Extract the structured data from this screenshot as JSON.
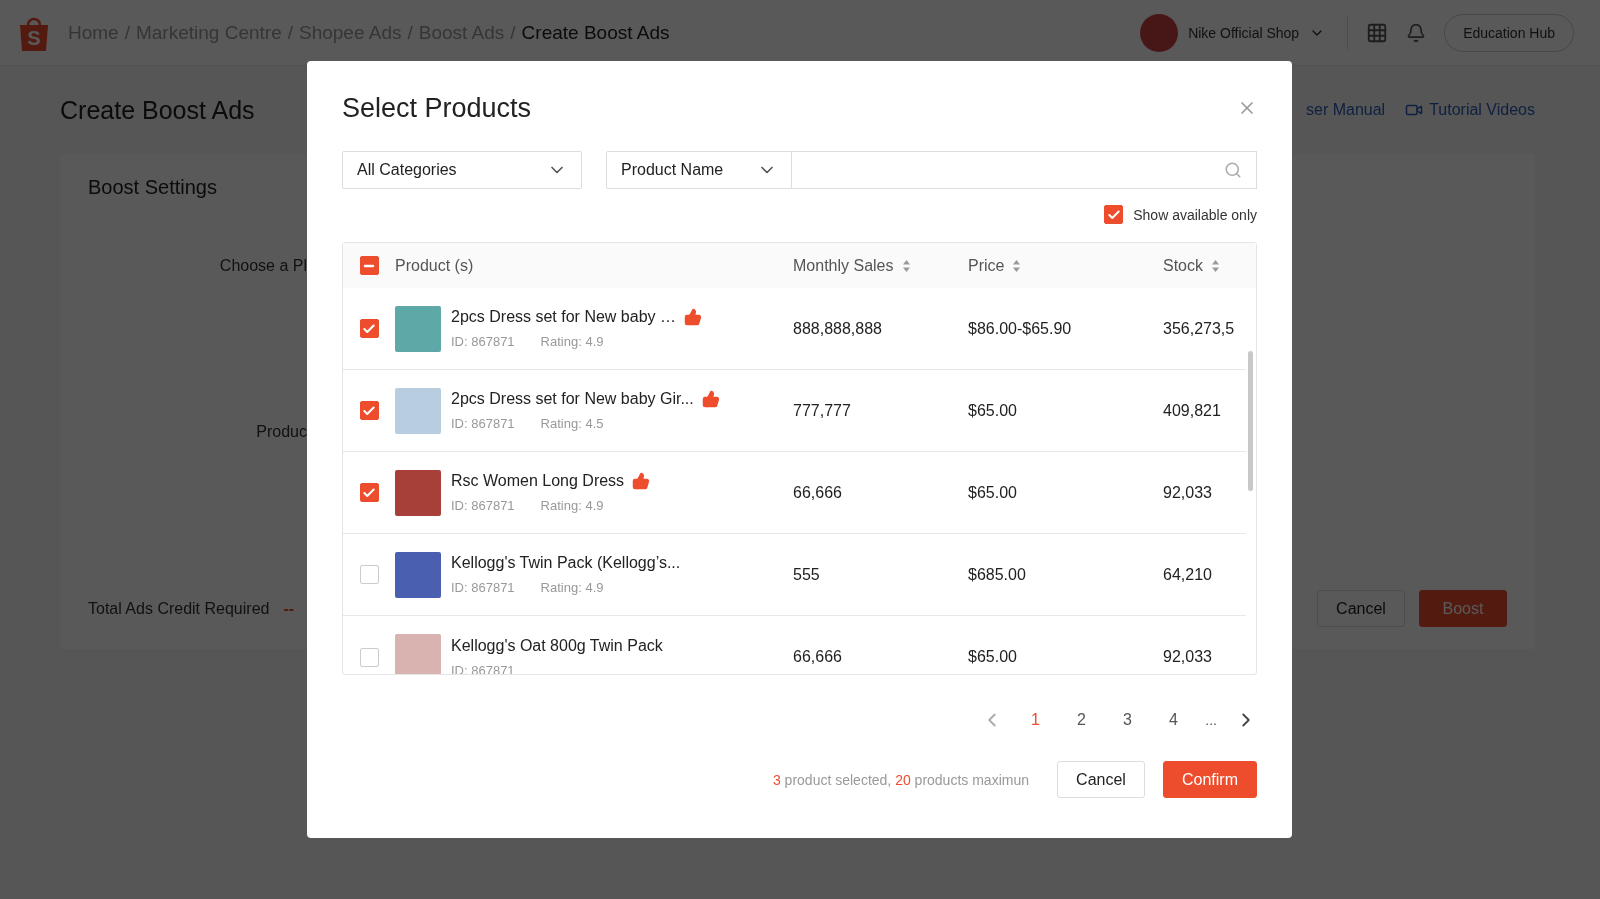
{
  "header": {
    "logo": {
      "letter": "S"
    },
    "breadcrumb": {
      "separator": "/",
      "items": [
        {
          "label": "Home",
          "current": false
        },
        {
          "label": "Marketing Centre",
          "current": false
        },
        {
          "label": "Shopee Ads",
          "current": false
        },
        {
          "label": "Boost Ads",
          "current": false
        },
        {
          "label": "Create Boost Ads",
          "current": true
        }
      ]
    },
    "shop": {
      "name": "Nike Official Shop"
    },
    "education_button": "Education Hub"
  },
  "page": {
    "title": "Create Boost Ads",
    "links": [
      "ser Manual",
      "Tutorial Videos"
    ],
    "card": {
      "title": "Boost Settings",
      "labels": [
        "Choose a Pl",
        "Produc"
      ],
      "credit_label": "Total Ads Credit Required",
      "credit_value": "--",
      "buttons": [
        {
          "label": "Cancel",
          "kind": "secondary"
        },
        {
          "label": "Boost",
          "kind": "primary"
        }
      ]
    }
  },
  "modal": {
    "title": "Select Products",
    "category_select": {
      "value": "All Categories"
    },
    "search_type_select": {
      "value": "Product Name"
    },
    "available_only": {
      "label": "Show available only",
      "checked": true
    },
    "table": {
      "header_checkbox": {
        "indeterminate": true
      },
      "columns": [
        {
          "label": "Product (s)",
          "sortable": false
        },
        {
          "label": "Monthly Sales",
          "sortable": true
        },
        {
          "label": "Price",
          "sortable": true
        },
        {
          "label": "Stock",
          "sortable": true
        }
      ],
      "rows": [
        {
          "selected": true,
          "name": "2pcs Dress set for New baby …",
          "recommended": true,
          "id": "ID: 867871",
          "rating": "Rating: 4.9",
          "sales": "888,888,888",
          "price": "$86.00-$65.90",
          "stock": "356,273,5",
          "color": "#5fa8a8"
        },
        {
          "selected": true,
          "name": "2pcs Dress set for New baby Gir...",
          "recommended": true,
          "id": "ID: 867871",
          "rating": "Rating: 4.5",
          "sales": "777,777",
          "price": "$65.00",
          "stock": "409,821",
          "color": "#b9cde0"
        },
        {
          "selected": true,
          "name": "Rsc Women Long Dress",
          "recommended": true,
          "id": "ID: 867871",
          "rating": "Rating: 4.9",
          "sales": "66,666",
          "price": "$65.00",
          "stock": "92,033",
          "color": "#a8403a"
        },
        {
          "selected": false,
          "name": "Kellogg's Twin Pack (Kellogg’s...",
          "recommended": false,
          "id": "ID: 867871",
          "rating": "Rating: 4.9",
          "sales": "555",
          "price": "$685.00",
          "stock": "64,210",
          "color": "#4a5fb0"
        },
        {
          "selected": false,
          "name": "Kellogg's Oat 800g Twin Pack",
          "recommended": false,
          "id": "ID: 867871",
          "sales": "66,666",
          "price": "$65.00",
          "stock": "92,033",
          "color": "#d9b3b0"
        }
      ]
    },
    "pagination": {
      "prev_disabled": true,
      "next_disabled": false,
      "pages": [
        {
          "label": "1",
          "kind": "page",
          "selected": true
        },
        {
          "label": "2",
          "kind": "page",
          "selected": false
        },
        {
          "label": "3",
          "kind": "page",
          "selected": false
        },
        {
          "label": "4",
          "kind": "page",
          "selected": false
        },
        {
          "label": "...",
          "kind": "ellipsis"
        }
      ]
    },
    "summary": "**3** product selected, **20** products maximun",
    "buttons": [
      {
        "label": "Cancel",
        "kind": "secondary"
      },
      {
        "label": "Confirm",
        "kind": "primary"
      }
    ]
  }
}
